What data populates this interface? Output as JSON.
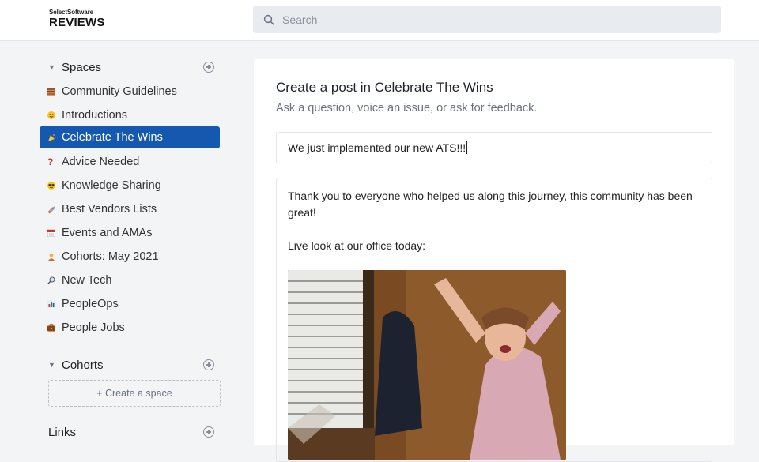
{
  "header": {
    "logo_small": "SelectSoftware",
    "logo_big": "REVIEWS",
    "search_placeholder": "Search"
  },
  "sidebar": {
    "spaces": {
      "title": "Spaces",
      "items": [
        {
          "label": "Community Guidelines",
          "icon": "books-icon"
        },
        {
          "label": "Introductions",
          "icon": "smiley-icon"
        },
        {
          "label": "Celebrate The Wins",
          "icon": "party-popper-icon",
          "active": true
        },
        {
          "label": "Advice Needed",
          "icon": "question-mark-icon"
        },
        {
          "label": "Knowledge Sharing",
          "icon": "sunglasses-face-icon"
        },
        {
          "label": "Best Vendors Lists",
          "icon": "rocket-icon"
        },
        {
          "label": "Events and AMAs",
          "icon": "calendar-icon"
        },
        {
          "label": "Cohorts: May 2021",
          "icon": "person-icon"
        },
        {
          "label": "New Tech",
          "icon": "magnifier-icon"
        },
        {
          "label": "PeopleOps",
          "icon": "bar-chart-icon"
        },
        {
          "label": "People Jobs",
          "icon": "briefcase-icon"
        }
      ]
    },
    "cohorts": {
      "title": "Cohorts",
      "create_label": "+ Create a space"
    },
    "links": {
      "title": "Links"
    }
  },
  "post": {
    "title": "Create a post in Celebrate The Wins",
    "subtitle": "Ask a question, voice an issue, or ask for feedback.",
    "title_value": "We just implemented our new ATS!!!",
    "body_paragraph_1": "Thank you to everyone who helped us along this journey, this community has been great!",
    "body_paragraph_2": "Live look at our office today:"
  },
  "colors": {
    "accent": "#1558b0",
    "background": "#f3f4f6"
  }
}
